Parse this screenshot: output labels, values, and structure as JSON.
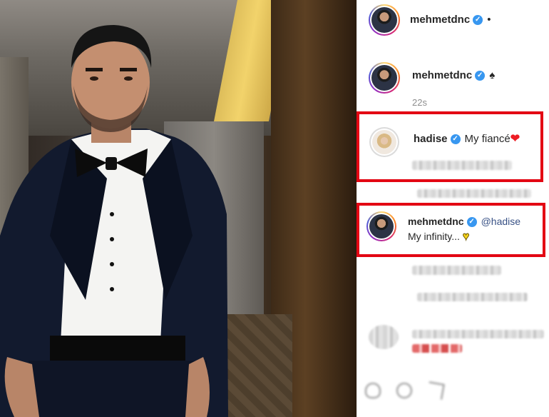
{
  "post": {
    "author": "mehmetdnc",
    "header_suffix": "•"
  },
  "caption": {
    "author": "mehmetdnc",
    "emoji": "♠",
    "time": "22s"
  },
  "comments": [
    {
      "author": "hadise",
      "text": "My fiancé",
      "emoji": "❤"
    },
    {
      "author": "mehmetdnc",
      "mention": "@hadise",
      "text": "My infinity...",
      "emoji": "♥"
    }
  ],
  "icons": {
    "verified": "verified-badge-icon",
    "heart": "heart-icon",
    "comment": "comment-icon",
    "share": "share-icon"
  },
  "colors": {
    "highlight_border": "#e30613",
    "verified_blue": "#3897f0",
    "mention": "#385185",
    "timestamp": "#8e8e8e"
  }
}
